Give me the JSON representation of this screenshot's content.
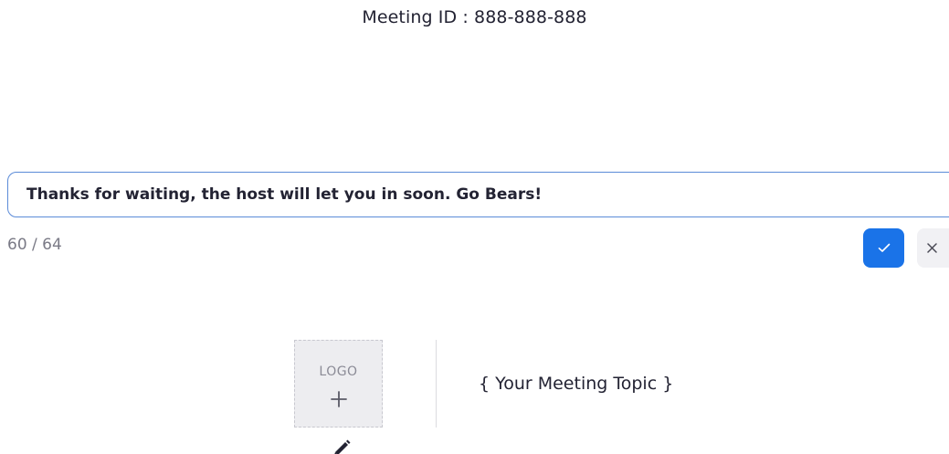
{
  "header": {
    "meeting_id": "Meeting ID : 888-888-888"
  },
  "message_editor": {
    "value": "Thanks for waiting, the host will let you in soon. Go Bears!",
    "char_count": "60 / 64",
    "confirm_icon": "check-icon",
    "cancel_icon": "close-icon",
    "confirm_color": "#1a73e8",
    "border_color": "#5b8bd8"
  },
  "branding": {
    "logo_label": "LOGO",
    "logo_add_icon": "plus-icon",
    "meeting_topic": "{ Your Meeting Topic }",
    "edit_icon": "pencil-icon"
  }
}
